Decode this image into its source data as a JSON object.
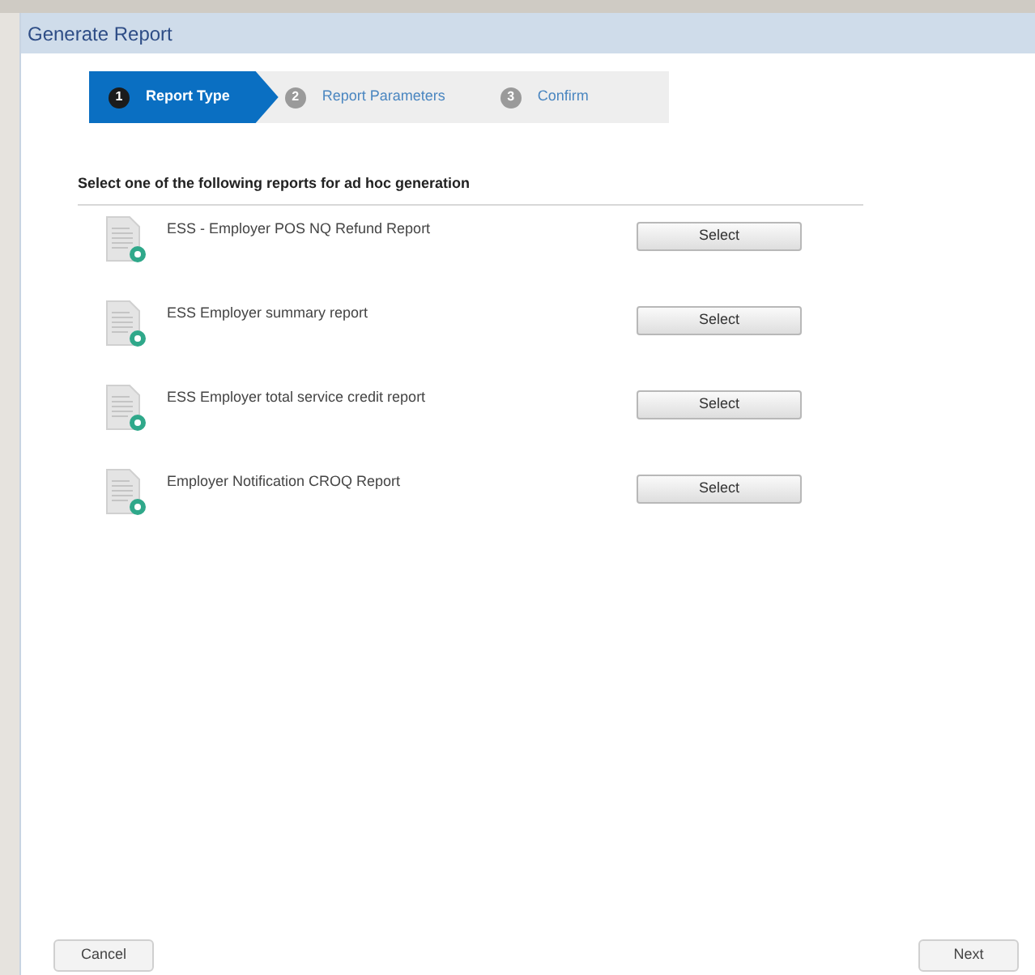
{
  "window": {
    "title": "Generate Report"
  },
  "steps": [
    {
      "number": "1",
      "label": "Report Type",
      "selected": true
    },
    {
      "number": "2",
      "label": "Report Parameters",
      "selected": false
    },
    {
      "number": "3",
      "label": "Confirm",
      "selected": false
    }
  ],
  "heading": "Select one of the following reports for ad hoc generation",
  "reports": [
    {
      "name": "ESS - Employer POS NQ Refund Report",
      "button": "Select"
    },
    {
      "name": "ESS Employer summary report",
      "button": "Select"
    },
    {
      "name": "ESS Employer total service credit report",
      "button": "Select"
    },
    {
      "name": "Employer Notification CROQ Report",
      "button": "Select"
    }
  ],
  "footer": {
    "cancel": "Cancel",
    "next": "Next"
  }
}
